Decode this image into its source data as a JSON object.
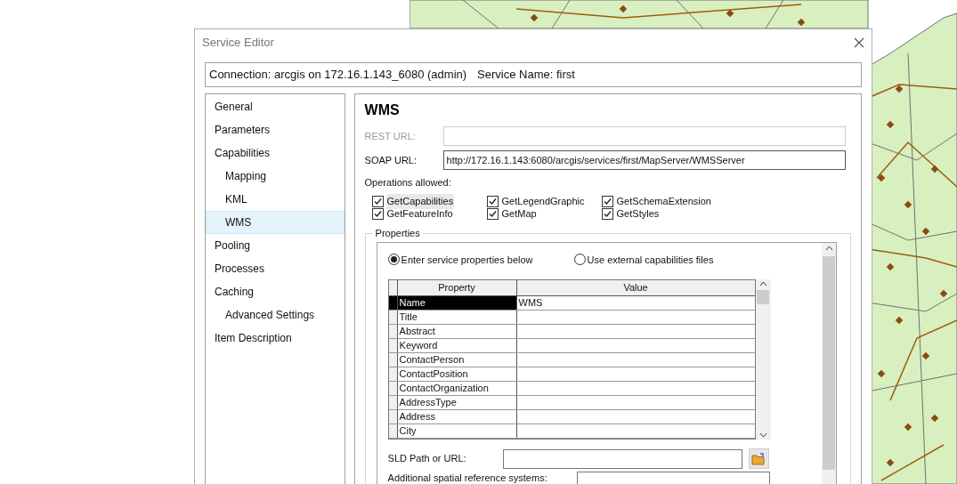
{
  "window": {
    "title": "Service Editor"
  },
  "connection_bar": {
    "connection": "Connection: arcgis on 172.16.1.143_6080 (admin)",
    "service_name": "Service Name: first"
  },
  "sidebar": {
    "items": [
      {
        "label": "General",
        "selected": false
      },
      {
        "label": "Parameters",
        "selected": false
      },
      {
        "label": "Capabilities",
        "selected": false,
        "children": [
          {
            "label": "Mapping",
            "selected": false
          },
          {
            "label": "KML",
            "selected": false
          },
          {
            "label": "WMS",
            "selected": true
          }
        ]
      },
      {
        "label": "Pooling",
        "selected": false
      },
      {
        "label": "Processes",
        "selected": false
      },
      {
        "label": "Caching",
        "selected": false,
        "children": [
          {
            "label": "Advanced Settings",
            "selected": false
          }
        ]
      },
      {
        "label": "Item Description",
        "selected": false
      }
    ]
  },
  "panel": {
    "heading": "WMS",
    "fields": [
      {
        "label": "REST URL:",
        "disabled": true
      },
      {
        "label": "SOAP URL:",
        "disabled": false,
        "value": "http://172.16.1.143:6080/arcgis/services/first/MapServer/WMSServer"
      }
    ],
    "operations_label": "Operations allowed:",
    "operations": [
      {
        "label": "GetCapabilities",
        "checked": true,
        "focused": true
      },
      {
        "label": "GetLegendGraphic",
        "checked": true,
        "focused": false
      },
      {
        "label": "GetSchemaExtension",
        "checked": true,
        "focused": false
      },
      {
        "label": "GetFeatureInfo",
        "checked": true,
        "focused": false
      },
      {
        "label": "GetMap",
        "checked": true,
        "focused": false
      },
      {
        "label": "GetStyles",
        "checked": true,
        "focused": false
      }
    ],
    "properties": {
      "title": "Properties",
      "modes": [
        {
          "label": "Enter service properties below",
          "selected": true
        },
        {
          "label": "Use external capabilities files",
          "selected": false
        }
      ],
      "columns": [
        "Property",
        "Value"
      ],
      "rows": [
        {
          "property": "Name",
          "value": "WMS",
          "selected": true
        },
        {
          "property": "Title",
          "selected": false
        },
        {
          "property": "Abstract",
          "selected": false
        },
        {
          "property": "Keyword",
          "selected": false
        },
        {
          "property": "ContactPerson",
          "selected": false
        },
        {
          "property": "ContactPosition",
          "selected": false
        },
        {
          "property": "ContactOrganization",
          "selected": false
        },
        {
          "property": "AddressType",
          "selected": false
        },
        {
          "property": "Address",
          "selected": false
        },
        {
          "property": "City",
          "selected": false
        }
      ],
      "sld_label": "SLD Path or URL:",
      "additional_label": "Additional spatial reference systems:"
    }
  }
}
